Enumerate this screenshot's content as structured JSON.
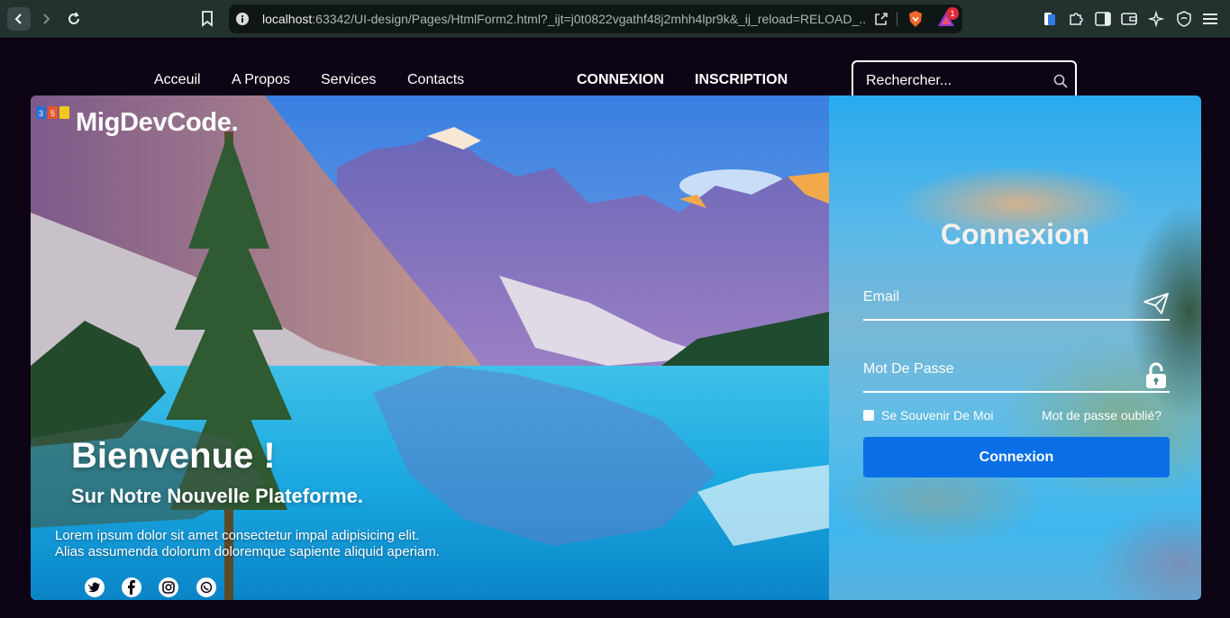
{
  "browser": {
    "url_host": "localhost",
    "url_rest": ":63342/UI-design/Pages/HtmlForm2.html?_ijt=j0t0822vgathf48j2mhh4lpr9k&_ij_reload=RELOAD_...",
    "rewards_badge": "1"
  },
  "nav": {
    "links": [
      "Acceuil",
      "A Propos",
      "Services",
      "Contacts"
    ],
    "connexion": "CONNEXION",
    "inscription": "INSCRIPTION"
  },
  "search": {
    "placeholder": "Rechercher..."
  },
  "brand": {
    "name": "MigDevCode."
  },
  "hero": {
    "title": "Bienvenue !",
    "subtitle": "Sur Notre Nouvelle Plateforme.",
    "desc_line1": "Lorem ipsum dolor sit amet consectetur impal adipisicing elit.",
    "desc_line2": "Alias assumenda dolorum doloremque sapiente aliquid aperiam."
  },
  "login": {
    "title": "Connexion",
    "email_label": "Email",
    "password_label": "Mot De Passe",
    "remember_label": "Se Souvenir De Moi",
    "forgot_label": "Mot de passe oublié?",
    "button_label": "Connexion"
  },
  "colors": {
    "page_bg": "#0c0414",
    "accent": "#0a6fe6",
    "chrome_bg": "#23312f"
  }
}
